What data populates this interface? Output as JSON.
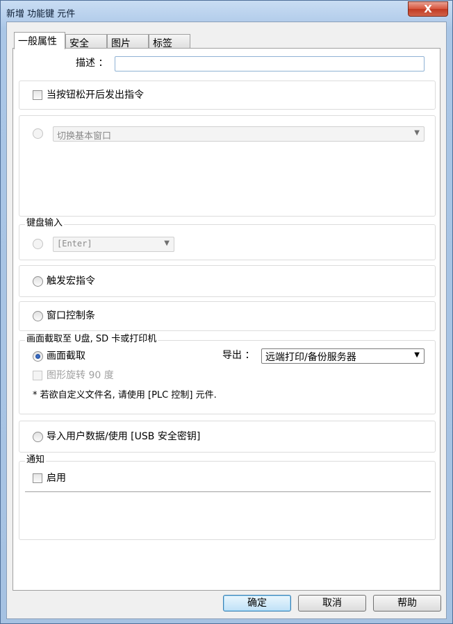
{
  "window": {
    "title": "新增 功能键 元件",
    "close_glyph": "X"
  },
  "tabs": [
    {
      "label": "一般属性",
      "active": true
    },
    {
      "label": "安全",
      "active": false
    },
    {
      "label": "图片",
      "active": false
    },
    {
      "label": "标签",
      "active": false
    }
  ],
  "description": {
    "label": "描述 ：",
    "value": ""
  },
  "release_command": {
    "label": "当按钮松开后发出指令",
    "checked": false
  },
  "switch_window": {
    "option": "切换基本窗口",
    "checked": false
  },
  "keyboard_input": {
    "caption": "键盘输入",
    "option": "[Enter]",
    "checked": false
  },
  "trigger_macro": {
    "label": "触发宏指令",
    "checked": false
  },
  "window_bar": {
    "label": "窗口控制条",
    "checked": false
  },
  "screen_capture": {
    "caption": "画面截取至 U盘, SD 卡或打印机",
    "capture_label": "画面截取",
    "capture_checked": true,
    "export_label": "导出 ：",
    "export_value": "远端打印/备份服务器",
    "rotate_label": "图形旋转 90 度",
    "note": "* 若欲自定义文件名, 请使用 [PLC 控制] 元件."
  },
  "import_user": {
    "label": "导入用户数据/使用 [USB 安全密钥]",
    "checked": false
  },
  "notification": {
    "caption": "通知",
    "enable_label": "启用",
    "checked": false
  },
  "buttons": {
    "ok": "确定",
    "cancel": "取消",
    "help": "帮助"
  },
  "colors": {
    "title_bar": "#b6cfec",
    "close_button": "#c13a22",
    "default_button_border": "#3c7fb1"
  }
}
